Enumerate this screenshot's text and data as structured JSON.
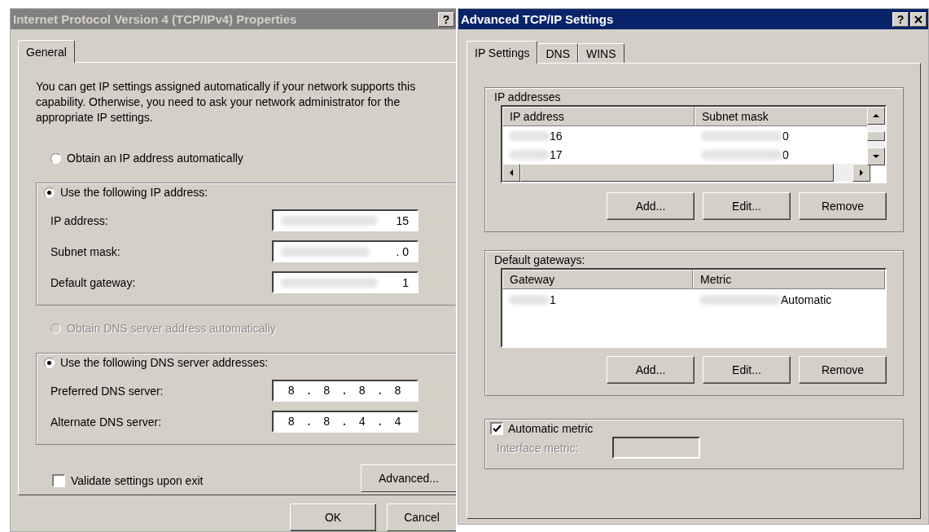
{
  "ipv4_window": {
    "title": "Internet Protocol Version 4 (TCP/IPv4) Properties",
    "active": false,
    "help_button": "?",
    "tabs": [
      {
        "label": "General",
        "selected": true
      }
    ],
    "description": "You can get IP settings assigned automatically if your network supports this capability. Otherwise, you need to ask your network administrator for the appropriate IP settings.",
    "ip_options": [
      {
        "label": "Obtain an IP address automatically",
        "selected": false
      },
      {
        "label": "Use the following IP address:",
        "selected": true
      }
    ],
    "ip_fields": [
      {
        "label": "IP address:",
        "value": "15",
        "redacted": true
      },
      {
        "label": "Subnet mask:",
        "value": ". 0",
        "redacted": true
      },
      {
        "label": "Default gateway:",
        "value": "1",
        "redacted": true
      }
    ],
    "dns_options": [
      {
        "label": "Obtain DNS server address automatically",
        "selected": false,
        "disabled": true
      },
      {
        "label": "Use the following DNS server addresses:",
        "selected": true
      }
    ],
    "dns_fields": [
      {
        "label": "Preferred DNS server:",
        "value": "8 . 8 . 8 . 8"
      },
      {
        "label": "Alternate DNS server:",
        "value": "8 . 8 . 4 . 4"
      }
    ],
    "validate": {
      "label": "Validate settings upon exit",
      "checked": false
    },
    "advanced_button": "Advanced...",
    "buttons": [
      "OK",
      "Cancel"
    ]
  },
  "advanced_window": {
    "title": "Advanced TCP/IP Settings",
    "active": true,
    "help_button": "?",
    "tabs": [
      {
        "label": "IP Settings",
        "selected": true
      },
      {
        "label": "DNS",
        "selected": false
      },
      {
        "label": "WINS",
        "selected": false
      }
    ],
    "ip_addresses": {
      "title": "IP addresses",
      "columns": [
        "IP address",
        "Subnet mask"
      ],
      "rows": [
        {
          "cells": [
            "16",
            "0"
          ],
          "redacted": true
        },
        {
          "cells": [
            "17",
            "0"
          ],
          "redacted": true
        }
      ],
      "buttons": [
        "Add...",
        "Edit...",
        "Remove"
      ]
    },
    "gateways": {
      "title": "Default gateways:",
      "columns": [
        "Gateway",
        "Metric"
      ],
      "rows": [
        {
          "cells": [
            "1",
            "Automatic"
          ],
          "redacted": true
        }
      ],
      "buttons": [
        "Add...",
        "Edit...",
        "Remove"
      ]
    },
    "automatic_metric": {
      "label": "Automatic metric",
      "checked": true
    },
    "interface_metric": {
      "label": "Interface metric:",
      "disabled": true
    }
  }
}
